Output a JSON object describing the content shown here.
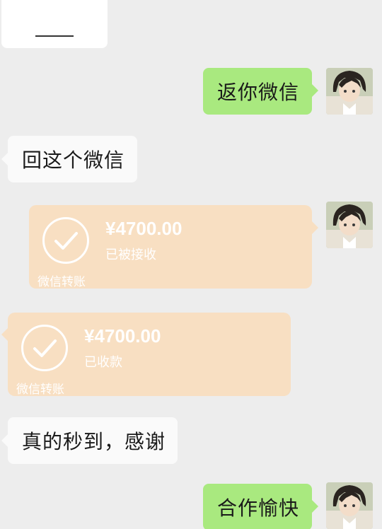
{
  "messages": {
    "m1": "返你微信",
    "m2": "回这个微信",
    "transfer_sent": {
      "amount": "¥4700.00",
      "status": "已被接收",
      "label": "微信转账"
    },
    "transfer_received": {
      "amount": "¥4700.00",
      "status": "已收款",
      "label": "微信转账"
    },
    "m3": "真的秒到，感谢",
    "m4": "合作愉快"
  },
  "colors": {
    "background": "#ededed",
    "sent_bubble": "#a9e97f",
    "received_bubble": "#fafafa",
    "transfer_card": "#f8dfc2"
  },
  "icons": [
    "check-circle-icon",
    "user-avatar"
  ]
}
